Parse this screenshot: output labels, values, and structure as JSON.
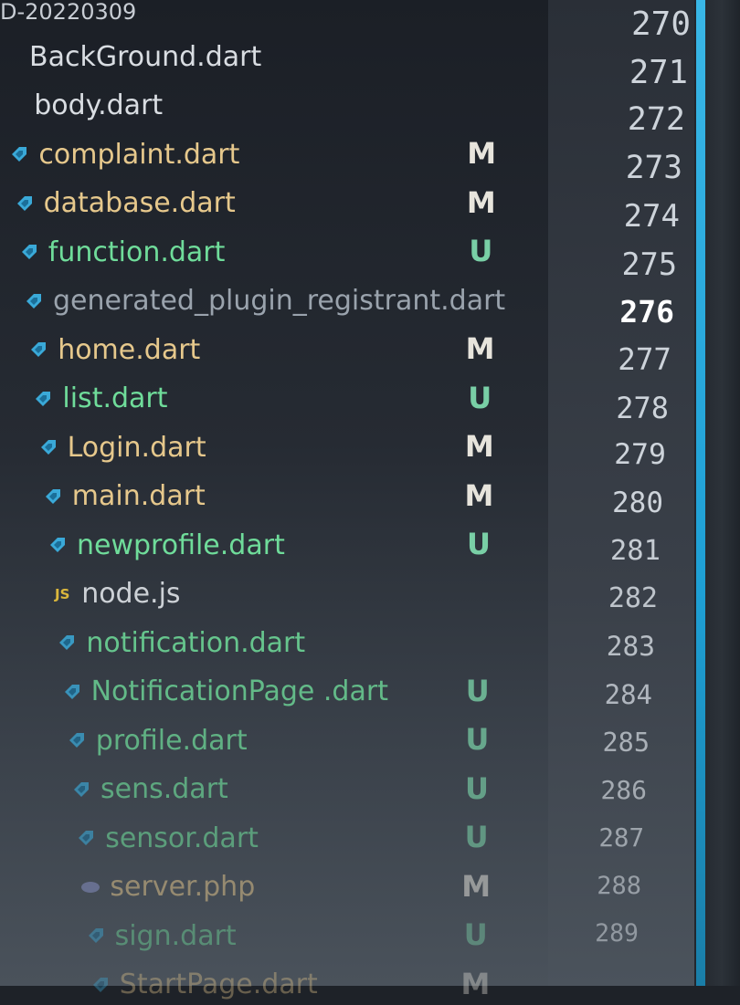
{
  "header": {
    "tab_title": "D-20220309"
  },
  "files": [
    {
      "name": "BackGround.dart",
      "status": "",
      "color": "default",
      "icon": "dart-icon"
    },
    {
      "name": "body.dart",
      "status": "",
      "color": "default",
      "icon": "dart-icon"
    },
    {
      "name": "complaint.dart",
      "status": "M",
      "color": "mod",
      "icon": "dart-icon"
    },
    {
      "name": "database.dart",
      "status": "M",
      "color": "mod",
      "icon": "dart-icon"
    },
    {
      "name": "function.dart",
      "status": "U",
      "color": "untracked",
      "icon": "dart-icon"
    },
    {
      "name": "generated_plugin_registrant.dart",
      "status": "",
      "color": "ignored",
      "icon": "dart-icon"
    },
    {
      "name": "home.dart",
      "status": "M",
      "color": "mod",
      "icon": "dart-icon"
    },
    {
      "name": "list.dart",
      "status": "U",
      "color": "untracked",
      "icon": "dart-icon"
    },
    {
      "name": "Login.dart",
      "status": "M",
      "color": "mod",
      "icon": "dart-icon"
    },
    {
      "name": "main.dart",
      "status": "M",
      "color": "mod",
      "icon": "dart-icon"
    },
    {
      "name": "newprofile.dart",
      "status": "U",
      "color": "untracked",
      "icon": "dart-icon"
    },
    {
      "name": "node.js",
      "status": "",
      "color": "default",
      "icon": "js-icon"
    },
    {
      "name": "notification.dart",
      "status": "",
      "color": "untracked",
      "icon": "dart-icon"
    },
    {
      "name": "NotificationPage .dart",
      "status": "U",
      "color": "untracked",
      "icon": "dart-icon"
    },
    {
      "name": "profile.dart",
      "status": "U",
      "color": "untracked",
      "icon": "dart-icon"
    },
    {
      "name": "sens.dart",
      "status": "U",
      "color": "untracked",
      "icon": "dart-icon"
    },
    {
      "name": "sensor.dart",
      "status": "U",
      "color": "untracked",
      "icon": "dart-icon"
    },
    {
      "name": "server.php",
      "status": "M",
      "color": "mod",
      "icon": "php-icon"
    },
    {
      "name": "sign.dart",
      "status": "U",
      "color": "untracked",
      "icon": "dart-icon"
    },
    {
      "name": "StartPage.dart",
      "status": "M",
      "color": "mod",
      "icon": "dart-icon"
    }
  ],
  "line_numbers": [
    "270",
    "271",
    "272",
    "273",
    "274",
    "275",
    "276",
    "277",
    "278",
    "279",
    "280",
    "281",
    "282",
    "283",
    "284",
    "285",
    "286",
    "287",
    "288",
    "289"
  ],
  "current_line": "276",
  "colors": {
    "accent": "#1e9fd4",
    "modified": "#e6c88c",
    "untracked": "#6fdc9a"
  }
}
